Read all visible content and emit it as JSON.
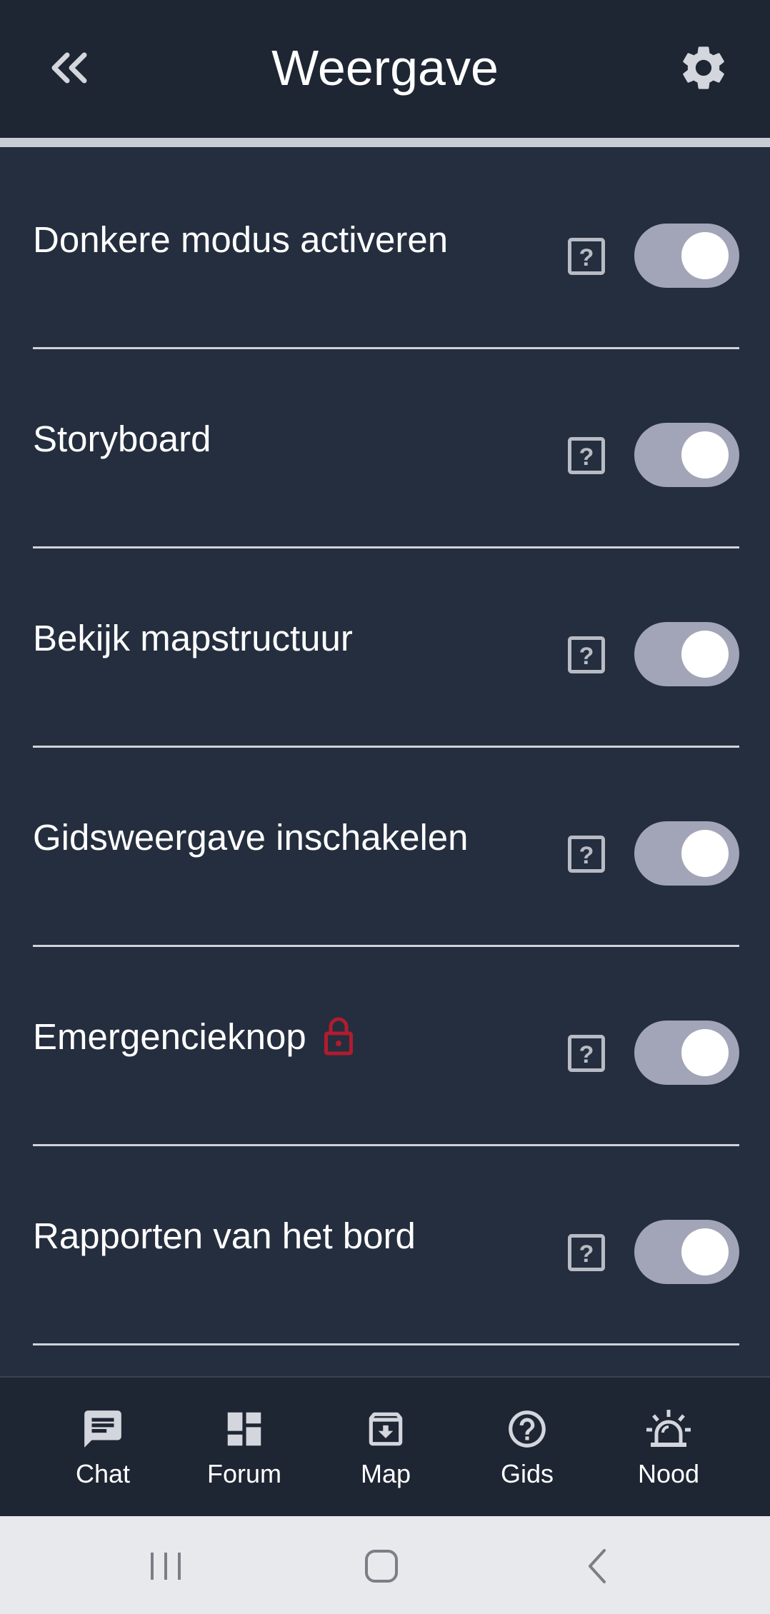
{
  "header": {
    "title": "Weergave",
    "back_icon": "double-chevron-left-icon",
    "settings_icon": "gear-icon"
  },
  "settings": [
    {
      "label": "Donkere modus activeren",
      "locked": false,
      "enabled": true
    },
    {
      "label": "Storyboard",
      "locked": false,
      "enabled": true
    },
    {
      "label": "Bekijk mapstructuur",
      "locked": false,
      "enabled": true
    },
    {
      "label": "Gidsweergave inschakelen",
      "locked": false,
      "enabled": true
    },
    {
      "label": "Emergencieknop",
      "locked": true,
      "enabled": true
    },
    {
      "label": "Rapporten van het bord",
      "locked": false,
      "enabled": true
    }
  ],
  "bottom_nav": [
    {
      "label": "Chat",
      "icon": "chat-icon"
    },
    {
      "label": "Forum",
      "icon": "dashboard-icon"
    },
    {
      "label": "Map",
      "icon": "archive-icon"
    },
    {
      "label": "Gids",
      "icon": "help-circle-icon"
    },
    {
      "label": "Nood",
      "icon": "siren-icon"
    }
  ],
  "colors": {
    "header_bg": "#1e2533",
    "page_bg": "#252e3e",
    "toggle_track": "#a2a5b7",
    "lock": "#b01c2e"
  }
}
